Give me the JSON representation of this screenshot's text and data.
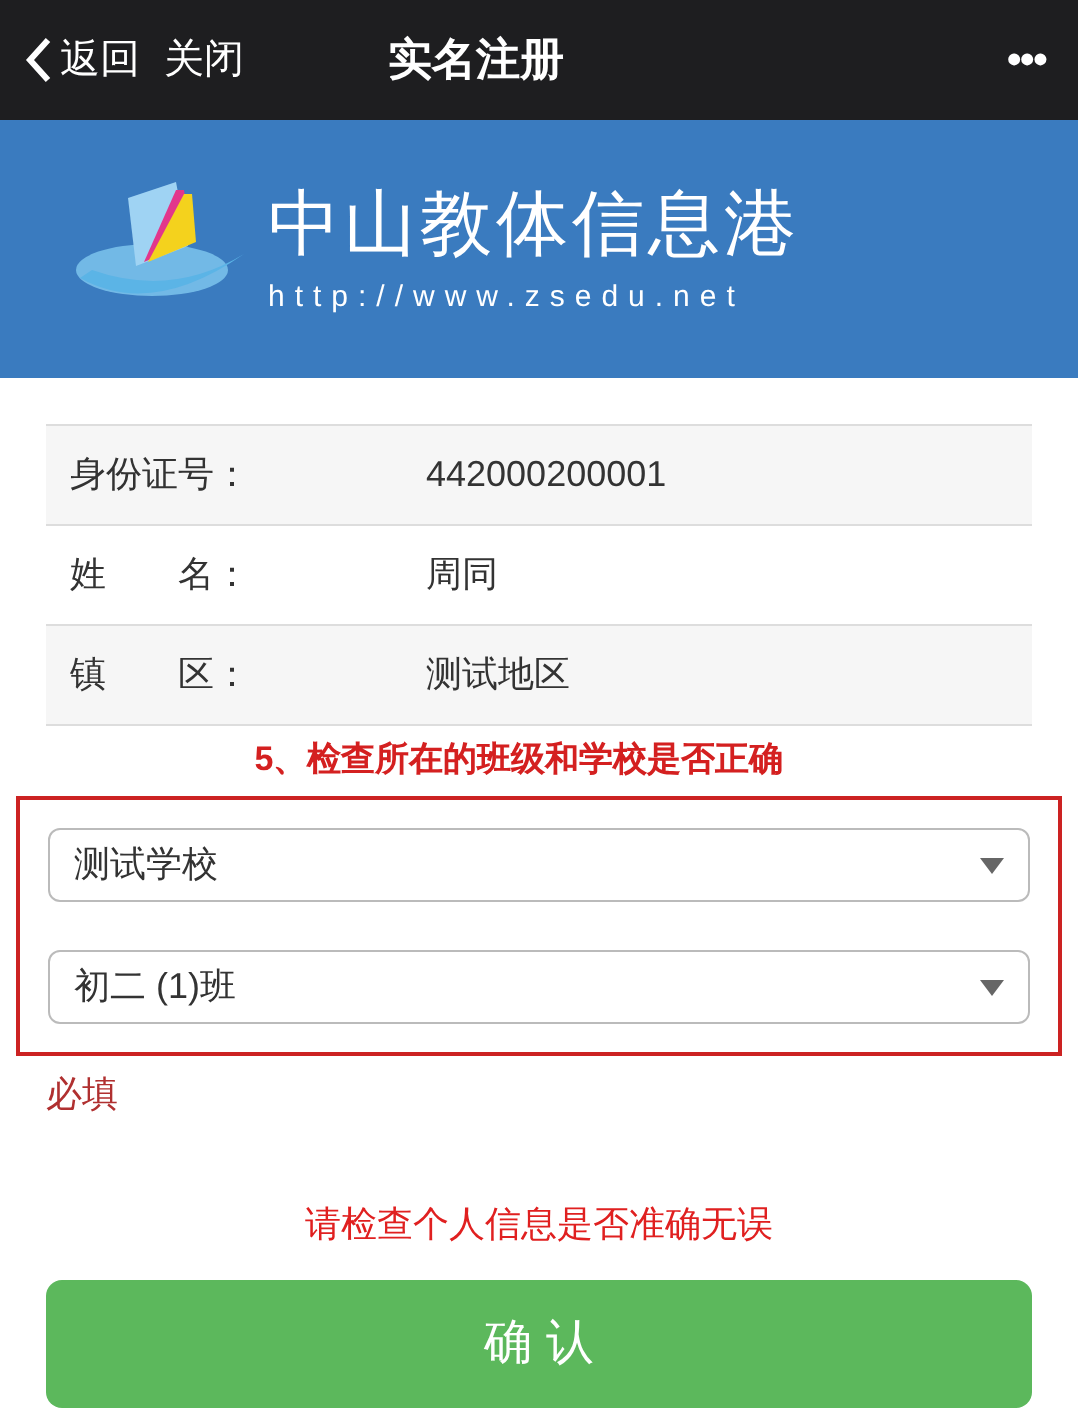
{
  "nav": {
    "back": "返回",
    "close": "关闭",
    "title": "实名注册",
    "more": "•••"
  },
  "banner": {
    "title": "中山教体信息港",
    "url": "http://www.zsedu.net"
  },
  "info_rows": [
    {
      "label": "身份证号：",
      "value": "442000200001"
    },
    {
      "label": "姓　　名：",
      "value": "周同"
    },
    {
      "label": "镇　　区：",
      "value": "测试地区"
    }
  ],
  "annotation": "5、检查所在的班级和学校是否正确",
  "selects": [
    {
      "value": "测试学校"
    },
    {
      "value": "初二 (1)班"
    }
  ],
  "required_note": "必填",
  "check_message": "请检查个人信息是否准确无误",
  "confirm_button": "确 认"
}
